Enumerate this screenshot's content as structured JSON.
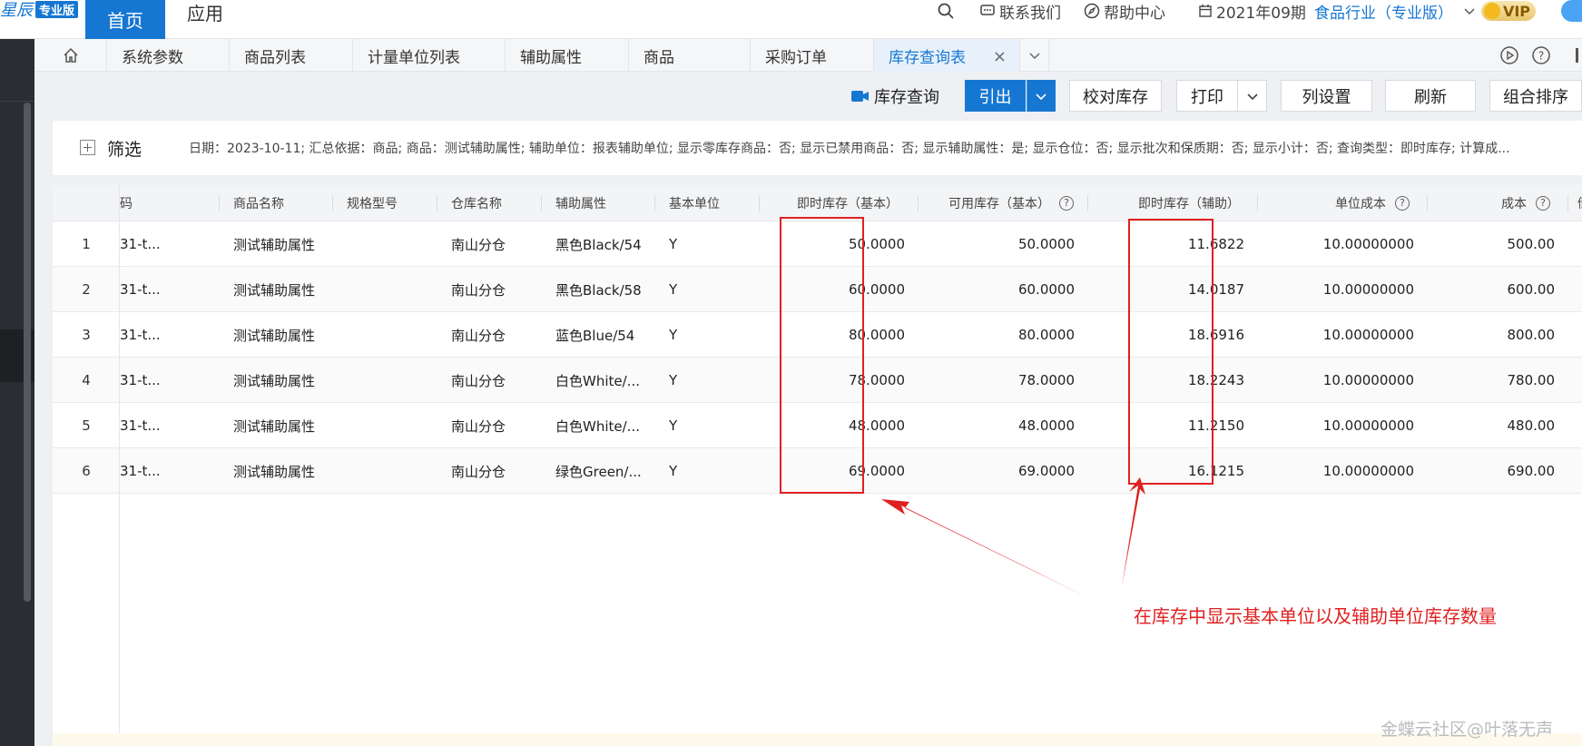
{
  "header": {
    "brand": "星辰",
    "edition": "专业版",
    "nav": {
      "home": "首页",
      "app": "应用"
    },
    "contact": "联系我们",
    "help": "帮助中心",
    "period": "2021年09期",
    "industry": "食品行业（专业版）",
    "vip": "VIP"
  },
  "tabs": [
    {
      "label": "系统参数"
    },
    {
      "label": "商品列表"
    },
    {
      "label": "计量单位列表"
    },
    {
      "label": "辅助属性"
    },
    {
      "label": "商品"
    },
    {
      "label": "采购订单"
    },
    {
      "label": "库存查询表",
      "active": true
    }
  ],
  "toolbar": {
    "title": "库存查询",
    "export": "引出",
    "check_stock": "校对库存",
    "print": "打印",
    "columns": "列设置",
    "refresh": "刷新",
    "sort": "组合排序"
  },
  "filter": {
    "label": "筛选",
    "summary": "日期：2023-10-11; 汇总依据：商品; 商品：测试辅助属性; 辅助单位：报表辅助单位; 显示零库存商品：否; 显示已禁用商品：否; 显示辅助属性：是; 显示仓位：否; 显示批次和保质期：否; 显示小计：否; 查询类型：即时库存; 计算成..."
  },
  "grid": {
    "columns": [
      "码",
      "商品名称",
      "规格型号",
      "仓库名称",
      "辅助属性",
      "基本单位",
      "即时库存（基本）",
      "可用库存（基本）",
      "即时库存（辅助）",
      "单位成本",
      "成本",
      "储存"
    ],
    "rows": [
      {
        "index": "1",
        "code": "31-t...",
        "name": "测试辅助属性",
        "spec": "",
        "warehouse": "南山分仓",
        "attr": "黑色Black/54",
        "unit": "Y",
        "qty_base": "50.0000",
        "avail_base": "50.0000",
        "qty_aux": "11.6822",
        "unit_cost": "10.00000000",
        "cost": "500.00"
      },
      {
        "index": "2",
        "code": "31-t...",
        "name": "测试辅助属性",
        "spec": "",
        "warehouse": "南山分仓",
        "attr": "黑色Black/58",
        "unit": "Y",
        "qty_base": "60.0000",
        "avail_base": "60.0000",
        "qty_aux": "14.0187",
        "unit_cost": "10.00000000",
        "cost": "600.00"
      },
      {
        "index": "3",
        "code": "31-t...",
        "name": "测试辅助属性",
        "spec": "",
        "warehouse": "南山分仓",
        "attr": "蓝色Blue/54",
        "unit": "Y",
        "qty_base": "80.0000",
        "avail_base": "80.0000",
        "qty_aux": "18.6916",
        "unit_cost": "10.00000000",
        "cost": "800.00"
      },
      {
        "index": "4",
        "code": "31-t...",
        "name": "测试辅助属性",
        "spec": "",
        "warehouse": "南山分仓",
        "attr": "白色White/...",
        "unit": "Y",
        "qty_base": "78.0000",
        "avail_base": "78.0000",
        "qty_aux": "18.2243",
        "unit_cost": "10.00000000",
        "cost": "780.00"
      },
      {
        "index": "5",
        "code": "31-t...",
        "name": "测试辅助属性",
        "spec": "",
        "warehouse": "南山分仓",
        "attr": "白色White/...",
        "unit": "Y",
        "qty_base": "48.0000",
        "avail_base": "48.0000",
        "qty_aux": "11.2150",
        "unit_cost": "10.00000000",
        "cost": "480.00"
      },
      {
        "index": "6",
        "code": "31-t...",
        "name": "测试辅助属性",
        "spec": "",
        "warehouse": "南山分仓",
        "attr": "绿色Green/...",
        "unit": "Y",
        "qty_base": "69.0000",
        "avail_base": "69.0000",
        "qty_aux": "16.1215",
        "unit_cost": "10.00000000",
        "cost": "690.00"
      }
    ]
  },
  "annotation": {
    "text": "在库存中显示基本单位以及辅助单位库存数量",
    "color": "#e02020"
  },
  "watermark": "金蝶云社区@叶落无声",
  "colors": {
    "accent": "#1677d2",
    "sidebar": "#2b2d33",
    "annotation": "#e02020"
  }
}
